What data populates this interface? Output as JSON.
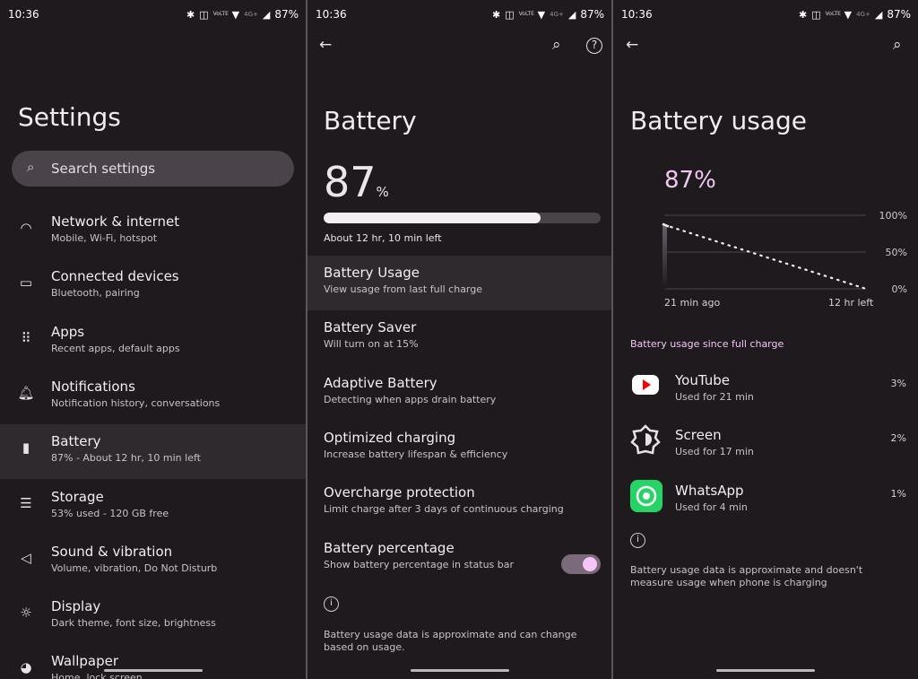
{
  "status_bar": {
    "time": "10:36",
    "battery": "87%",
    "network": "4G+",
    "volte": "VoLTE"
  },
  "settings": {
    "title": "Settings",
    "search_placeholder": "Search settings",
    "items": [
      {
        "title": "Network & internet",
        "subtitle": "Mobile, Wi-Fi, hotspot",
        "icon": "wifi-icon"
      },
      {
        "title": "Connected devices",
        "subtitle": "Bluetooth, pairing",
        "icon": "devices-icon"
      },
      {
        "title": "Apps",
        "subtitle": "Recent apps, default apps",
        "icon": "apps-grid-icon"
      },
      {
        "title": "Notifications",
        "subtitle": "Notification history, conversations",
        "icon": "bell-icon"
      },
      {
        "title": "Battery",
        "subtitle": "87% - About 12 hr, 10 min left",
        "icon": "battery-icon"
      },
      {
        "title": "Storage",
        "subtitle": "53% used - 120 GB free",
        "icon": "storage-icon"
      },
      {
        "title": "Sound & vibration",
        "subtitle": "Volume, vibration, Do Not Disturb",
        "icon": "speaker-icon"
      },
      {
        "title": "Display",
        "subtitle": "Dark theme, font size, brightness",
        "icon": "brightness-icon"
      },
      {
        "title": "Wallpaper",
        "subtitle": "Home, lock screen",
        "icon": "palette-icon"
      }
    ]
  },
  "battery": {
    "title": "Battery",
    "level": "87",
    "unit": "%",
    "level_fraction": 0.87,
    "time_left": "About 12 hr, 10 min left",
    "items": [
      {
        "title": "Battery Usage",
        "subtitle": "View usage from last full charge"
      },
      {
        "title": "Battery Saver",
        "subtitle": "Will turn on at 15%"
      },
      {
        "title": "Adaptive Battery",
        "subtitle": "Detecting when apps drain battery"
      },
      {
        "title": "Optimized charging",
        "subtitle": "Increase battery lifespan & efficiency"
      },
      {
        "title": "Overcharge protection",
        "subtitle": "Limit charge after 3 days of continuous charging"
      },
      {
        "title": "Battery percentage",
        "subtitle": "Show battery percentage in status bar",
        "toggle": true
      }
    ],
    "footer": "Battery usage data is approximate and can change based on usage."
  },
  "usage": {
    "title": "Battery usage",
    "level": "87%",
    "chart_data": {
      "type": "line",
      "y_ticks": [
        "100%",
        "50%",
        "0%"
      ],
      "x_labels": [
        "21 min ago",
        "12 hr left"
      ],
      "ylim": [
        0,
        100
      ],
      "series": [
        {
          "points": [
            {
              "x": "21 min ago",
              "y": 87
            },
            {
              "x": "12 hr left",
              "y": 0
            }
          ],
          "style": "dotted projection"
        }
      ],
      "grid": true
    },
    "section": "Battery usage since full charge",
    "apps": [
      {
        "name": "YouTube",
        "detail": "Used for 21 min",
        "percent": "3%",
        "icon": "youtube-icon",
        "color": "#ff0000"
      },
      {
        "name": "Screen",
        "detail": "Used for 17 min",
        "percent": "2%",
        "icon": "screen-brightness-icon"
      },
      {
        "name": "WhatsApp",
        "detail": "Used for 4 min",
        "percent": "1%",
        "icon": "whatsapp-icon",
        "color": "#25d366"
      }
    ],
    "footer": "Battery usage data is approximate and doesn't measure usage when phone is charging"
  },
  "colors": {
    "accent": "#f0c8f0",
    "toggle_track": "#7a6a7a",
    "toggle_thumb": "#f4c6f4"
  }
}
